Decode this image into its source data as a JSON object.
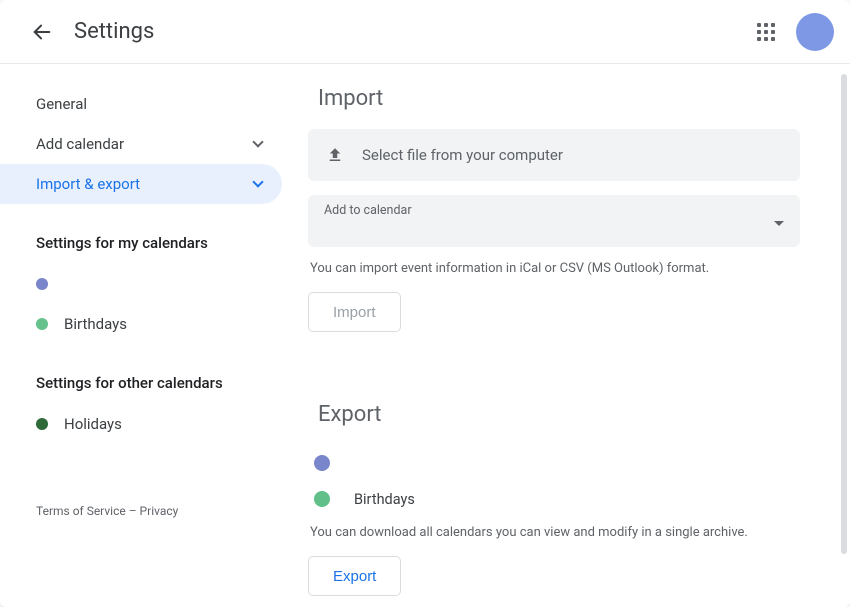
{
  "header": {
    "title": "Settings"
  },
  "sidebar": {
    "general": "General",
    "add_calendar": "Add calendar",
    "import_export": "Import & export",
    "my_cal_header": "Settings for my calendars",
    "my_cals": [
      {
        "name": "",
        "color": "#7986cb"
      },
      {
        "name": "Birthdays",
        "color": "#66c28d"
      }
    ],
    "other_cal_header": "Settings for other calendars",
    "other_cals": [
      {
        "name": "Holidays",
        "color": "#2f6b3a"
      }
    ],
    "footer": "Terms of Service – Privacy"
  },
  "import": {
    "title": "Import",
    "select_file": "Select file from your computer",
    "add_to_label": "Add to calendar",
    "hint": "You can import event information in iCal or CSV (MS Outlook) format.",
    "button": "Import"
  },
  "export": {
    "title": "Export",
    "cals": [
      {
        "name": "",
        "color": "#7986cb"
      },
      {
        "name": "Birthdays",
        "color": "#61c08a"
      }
    ],
    "hint": "You can download all calendars you can view and modify in a single archive.",
    "button": "Export"
  },
  "colors": {
    "avatar": "#7f98e6"
  }
}
